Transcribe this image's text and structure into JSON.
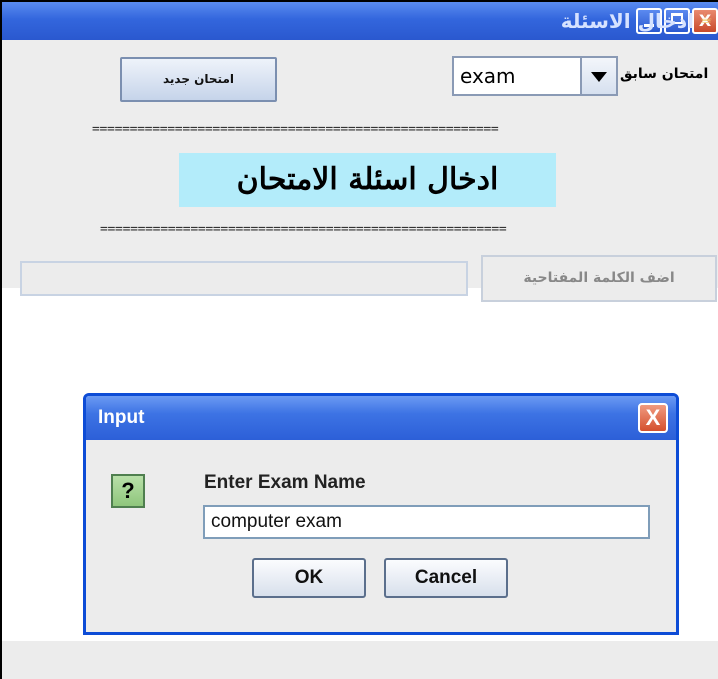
{
  "window": {
    "title": "ادخال الاسئلة",
    "icon": "java-coffee-icon",
    "controls": {
      "minimize": "minimize",
      "maximize": "maximize",
      "close": "X"
    }
  },
  "toolbar": {
    "new_exam_button": "امتحان جديد",
    "previous_exam_label": "امتحان سابق",
    "exam_select_value": "exam"
  },
  "separator_top": "======================================================",
  "separator_bottom": "======================================================",
  "heading": "ادخال اسئلة الامتحان",
  "keyword": {
    "button_label": "اضف الكلمة المفتاحية",
    "input_value": ""
  },
  "dialog": {
    "title": "Input",
    "close_glyph": "X",
    "icon": "question-icon",
    "icon_glyph": "?",
    "prompt": "Enter Exam Name",
    "input_value": "computer exam",
    "ok_label": "OK",
    "cancel_label": "Cancel"
  },
  "colors": {
    "titlebar": "#3366dd",
    "heading_bg": "#b3ecfa",
    "dialog_border": "#0d4cd6",
    "panel_bg": "#ededed"
  }
}
